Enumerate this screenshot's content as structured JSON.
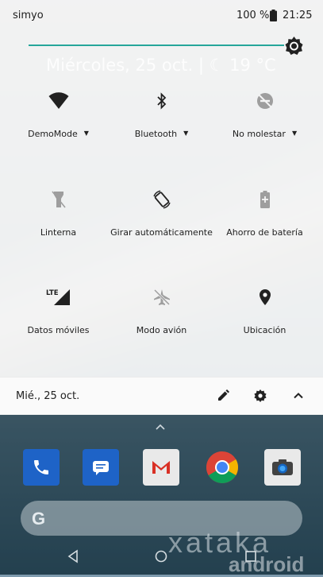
{
  "status_bar": {
    "carrier": "simyo",
    "battery_percent": "100 %",
    "time": "21:25"
  },
  "brightness": {
    "level": 0.96,
    "icon": "brightness-icon"
  },
  "ghost_date": "Miércoles, 25 oct.  |  ☾ 19 °C",
  "tiles": [
    {
      "label": "DemoMode",
      "icon": "wifi-icon",
      "has_dropdown": true
    },
    {
      "label": "Bluetooth",
      "icon": "bluetooth-icon",
      "has_dropdown": true
    },
    {
      "label": "No molestar",
      "icon": "do-not-disturb-icon",
      "has_dropdown": true
    },
    {
      "label": "Linterna",
      "icon": "flashlight-icon",
      "has_dropdown": false
    },
    {
      "label": "Girar automáticamente",
      "icon": "auto-rotate-icon",
      "has_dropdown": false
    },
    {
      "label": "Ahorro de batería",
      "icon": "battery-saver-icon",
      "has_dropdown": false
    },
    {
      "label": "Datos móviles",
      "icon": "mobile-data-icon",
      "icon_text": "LTE",
      "has_dropdown": false
    },
    {
      "label": "Modo avión",
      "icon": "airplane-mode-icon",
      "has_dropdown": false
    },
    {
      "label": "Ubicación",
      "icon": "location-icon",
      "has_dropdown": false
    }
  ],
  "footer": {
    "date": "Mié., 25 oct.",
    "edit_icon": "pencil-icon",
    "settings_icon": "gear-icon",
    "collapse_icon": "chevron-up-icon"
  },
  "home": {
    "search_letter": "G",
    "watermark_brand": "xataka",
    "watermark_sub": "android",
    "dock_apps": [
      "phone-icon",
      "messages-icon",
      "gmail-icon",
      "chrome-icon",
      "camera-icon"
    ]
  },
  "colors": {
    "accent": "#26a69a",
    "shade_bg": "#f4f4f4",
    "icon_active": "#212121",
    "icon_inactive": "#9e9e9e"
  }
}
